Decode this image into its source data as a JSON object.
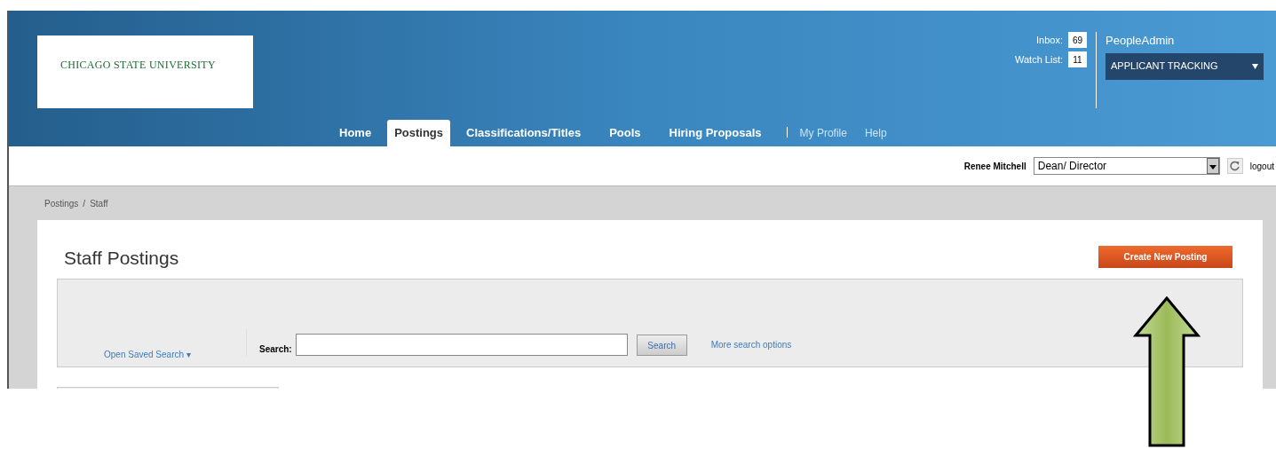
{
  "header": {
    "logo_text": "CHICAGO STATE UNIVERSITY",
    "inbox": {
      "label": "Inbox:",
      "count": "69"
    },
    "watch_list": {
      "label": "Watch List:",
      "count": "11"
    },
    "brand": "PeopleAdmin",
    "module_select": {
      "value": "APPLICANT TRACKING"
    }
  },
  "nav": {
    "tabs": [
      {
        "label": "Home",
        "selected": false
      },
      {
        "label": "Postings",
        "selected": true
      },
      {
        "label": "Classifications/Titles",
        "selected": false
      },
      {
        "label": "Pools",
        "selected": false
      },
      {
        "label": "Hiring Proposals",
        "selected": false
      }
    ],
    "secondary": [
      {
        "label": "My Profile"
      },
      {
        "label": "Help"
      }
    ]
  },
  "user_bar": {
    "user_name": "Renee Mitchell",
    "role_select": {
      "value": "Dean/ Director"
    },
    "logout": "logout"
  },
  "breadcrumb": [
    "Postings",
    "/",
    "Staff"
  ],
  "page": {
    "title": "Staff Postings",
    "create_button": "Create New Posting",
    "search": {
      "saved_search": "Open Saved Search ▾",
      "label": "Search:",
      "button": "Search",
      "more_options": "More search options"
    }
  }
}
